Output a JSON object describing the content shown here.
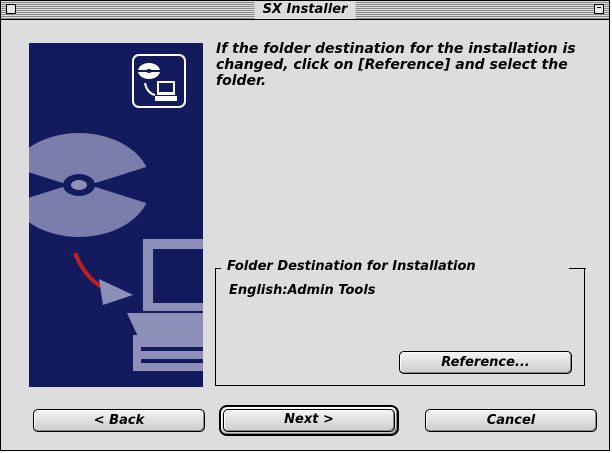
{
  "window": {
    "title": "SX Installer"
  },
  "instruction": "If the folder destination for the installation is changed, click on [Reference] and select the folder.",
  "destination_group": {
    "legend": "Folder Destination for Installation",
    "path": "English:Admin Tools",
    "reference_label": "Reference..."
  },
  "footer": {
    "back_label": "< Back",
    "next_label": "Next >",
    "cancel_label": "Cancel"
  },
  "icons": {
    "installer_art": "cd-to-computer-icon",
    "close": "close-box-icon",
    "zoom": "zoom-box-icon"
  },
  "colors": {
    "art_background": "#141a5e",
    "window_background": "#dddddd"
  }
}
